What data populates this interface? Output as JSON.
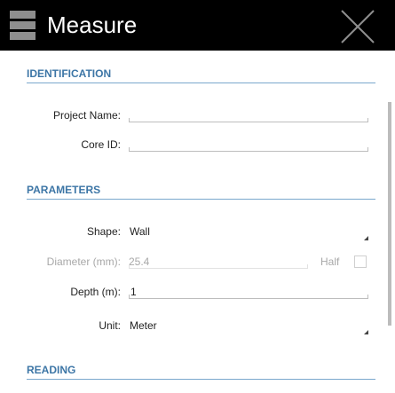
{
  "header": {
    "title": "Measure"
  },
  "sections": {
    "identification": "IDENTIFICATION",
    "parameters": "PARAMETERS",
    "reading": "READING"
  },
  "fields": {
    "project_name": {
      "label": "Project Name:",
      "value": ""
    },
    "core_id": {
      "label": "Core ID:",
      "value": ""
    },
    "shape": {
      "label": "Shape:",
      "value": "Wall"
    },
    "diameter": {
      "label": "Diameter (mm):",
      "value": "25.4",
      "half_label": "Half",
      "half_checked": false
    },
    "depth": {
      "label": "Depth (m):",
      "value": "1"
    },
    "unit": {
      "label": "Unit:",
      "value": "Meter"
    }
  },
  "icons": {
    "menu": "hamburger-icon",
    "close": "close-icon"
  },
  "colors": {
    "titlebar": "#000000",
    "section_text": "#3d76a6",
    "section_rule": "#7aa7cd",
    "disabled_text": "#a8a8a8"
  }
}
